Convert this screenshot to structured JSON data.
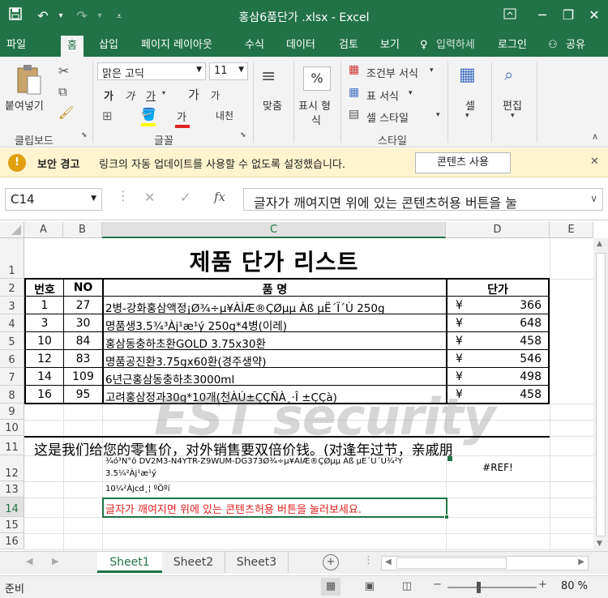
{
  "window": {
    "title": "홍삼6품단가 .xlsx  -  Excel"
  },
  "tabs": [
    "파일",
    "홈",
    "삽입",
    "페이지 레이아웃",
    "수식",
    "데이터",
    "검토",
    "보기"
  ],
  "tell_me": "입력하세",
  "login": "로그인",
  "share": "공유",
  "ribbon": {
    "paste_label": "붙여넣기",
    "clipboard": "클립보드",
    "font_name": "맑은 고딕",
    "font_size": "11",
    "font_group": "글꼴",
    "bold": "가",
    "italic": "가",
    "underline": "가",
    "grow": "가",
    "shrink": "가",
    "font_color": "가",
    "phonetic": "내천",
    "align_label": "맞춤",
    "number_label_1": "표시 형",
    "number_label_2": "식",
    "conditional": "조건부 서식",
    "table_format": "표 서식",
    "cell_style": "셀 스타일",
    "style_group": "스타일",
    "cells_label": "셀",
    "edit_label": "편집"
  },
  "security": {
    "title": "보안 경고",
    "message": "링크의 자동 업데이트를 사용할 수 없도록 설정했습니다.",
    "button": "콘텐츠 사용"
  },
  "formula_bar": {
    "name_box": "C14",
    "fx": "fx",
    "content": "글자가 깨여지면 위에 있는 콘텐츠허용 버튼을 눌"
  },
  "columns": [
    "A",
    "B",
    "C",
    "D",
    "E"
  ],
  "rows": [
    "1",
    "2",
    "3",
    "4",
    "5",
    "6",
    "7",
    "8",
    "9",
    "10",
    "11",
    "12",
    "13",
    "14",
    "15",
    "16"
  ],
  "sheet": {
    "title": "제품  단가  리스트",
    "headers": {
      "num": "번호",
      "no": "NO",
      "name": "품  명",
      "price": "단가"
    },
    "items": [
      {
        "num": "1",
        "no": "27",
        "name": "2병-강화홍삼액정¡Ø¾÷µ¥ÀÌÆ®ÇØµµ Àß µË´Ï´Ù 250g",
        "cur": "¥",
        "price": "366"
      },
      {
        "num": "3",
        "no": "30",
        "name": "명품생3.5¾³Àj¹æ¹ý 250g*4병(이레)",
        "cur": "¥",
        "price": "648"
      },
      {
        "num": "10",
        "no": "84",
        "name": "홍삼동충하초환GOLD 3.75x30환",
        "cur": "¥",
        "price": "458"
      },
      {
        "num": "12",
        "no": "83",
        "name": "명품공진환3.75gx60환(경주생약)",
        "cur": "¥",
        "price": "546"
      },
      {
        "num": "14",
        "no": "109",
        "name": "6년근홍삼동충하초3000ml",
        "cur": "¥",
        "price": "498"
      },
      {
        "num": "16",
        "no": "95",
        "name": "고려홍삼정과30g*10개(천ÀÚ±ÇÇÑÀ¸·Î ±ÇÇà)",
        "cur": "¥",
        "price": "458"
      }
    ],
    "row11": "这是我们给您的零售价，对外销售要双倍价钱。(对逢年过节，亲戚朋",
    "row12a": "¾ó³Ñ°ö DV2M3-N4YTR-Z9WUM-DG373Ø¾÷µ¥ÀÌÆ®ÇØµµ Àß µË´Ù´Ù¾²Ý",
    "row12b": "3.5¼²Àj¹æ¹ý",
    "row12d": "#REF!",
    "row13": "10¼²Àjcd¸¦ ºÖºí",
    "row14": "글자가 깨여지면 위에 있는 콘텐츠허용 버튼을 눌러보세요.",
    "watermark": "EST security"
  },
  "sheet_tabs": [
    "Sheet1",
    "Sheet2",
    "Sheet3"
  ],
  "status": {
    "ready": "준비",
    "zoom": "80 %"
  },
  "colors": {
    "excel_green": "#217346",
    "warning_bg": "#fff4ce",
    "red_text": "#e02020"
  }
}
